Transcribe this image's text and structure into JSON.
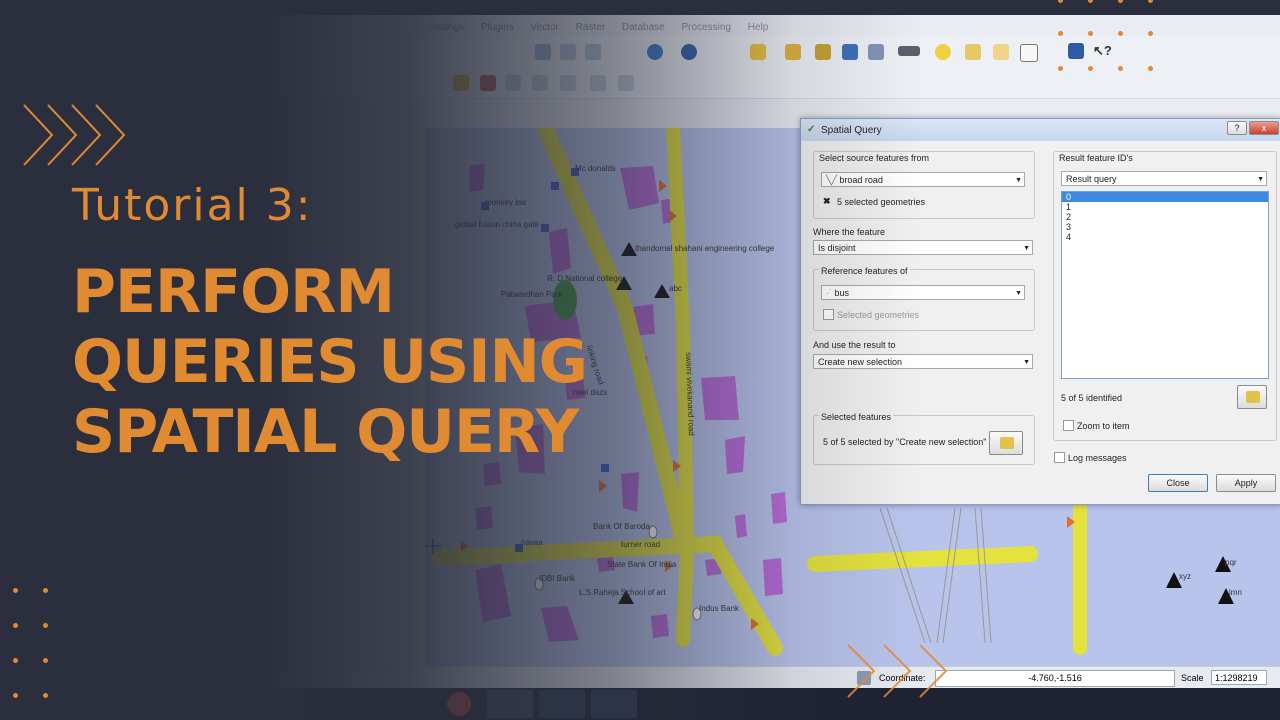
{
  "colors": {
    "accent": "#e08a32",
    "background": "#2b2f3d",
    "map_water": "#b9c4ec",
    "road_yellow": "#e4e23c",
    "poly_purple": "#b75bd6"
  },
  "overlay": {
    "subtitle": "Tutorial 3:",
    "title_lines": [
      "PERFORM",
      "QUERIES USING",
      "SPATIAL QUERY"
    ]
  },
  "qgis": {
    "menu": [
      "Settings",
      "Plugins",
      "Vector",
      "Raster",
      "Database",
      "Processing",
      "Help"
    ]
  },
  "map_labels": {
    "mcdonalds": "Mc donalds",
    "monkey_bar": "monkey bar",
    "global_fusion": "global fusion china gate",
    "thandomal": "thandomal shahani engineering college",
    "r_d_national": "R. D National college",
    "patwardhan": "Patwardhan Park",
    "abc": "abc",
    "linking_road": "linking road",
    "swami_road": "swami vivekanand road",
    "neel_dazs": "neel dazs",
    "bank_of_baroda": "Bank Of Baroda",
    "turner_road": "turner road",
    "navaa": "navaa",
    "idbi_bank": "IDBI Bank",
    "state_bank": "State Bank Of India",
    "ls_raheja": "L.S.Raheja School of art",
    "indus_bank": "Indus Bank",
    "xyz": "xyz",
    "pqr": "pqr",
    "lmn": "lmn"
  },
  "dialog": {
    "title": "Spatial Query",
    "help_btn": "?",
    "close_x": "x",
    "source_group": "Select source features from",
    "source_layer": "broad road",
    "source_selected": "5 selected geometries",
    "where_label": "Where the feature",
    "operator": "Is disjoint",
    "reference_group": "Reference features of",
    "reference_layer": "bus",
    "reference_selected": "Selected geometries",
    "use_result_label": "And use the result to",
    "result_action": "Create new selection",
    "selected_features_group": "Selected features",
    "selected_features_text": "5 of 5 selected by \"Create new selection\"",
    "result_ids_group": "Result feature ID's",
    "result_combo": "Result query",
    "result_ids": [
      "0",
      "1",
      "2",
      "3",
      "4"
    ],
    "identified_text": "5 of 5 identified",
    "zoom_to_item": "Zoom to item",
    "log_messages": "Log messages",
    "close_btn": "Close",
    "apply_btn": "Apply"
  },
  "statusbar": {
    "coordinate_label": "Coordinate:",
    "coordinate_value": "-4.760,-1.516",
    "scale_label": "Scale",
    "scale_value": "1:1298219"
  }
}
